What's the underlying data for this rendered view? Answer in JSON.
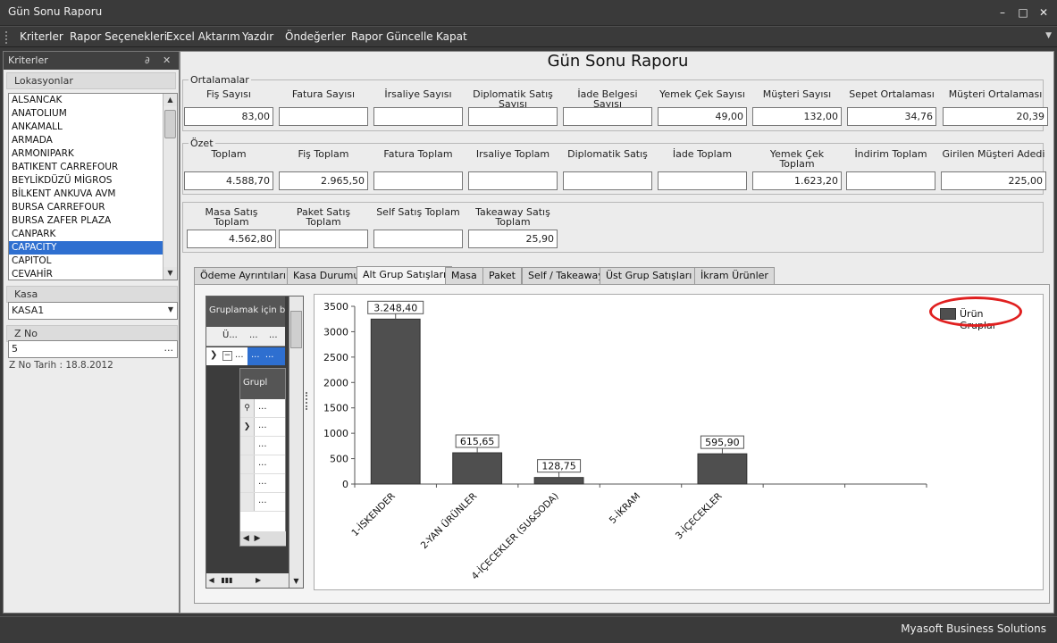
{
  "window": {
    "title": "Gün Sonu Raporu"
  },
  "menu": [
    "Kriterler",
    "Rapor Seçenekleri",
    "Excel Aktarım",
    "Yazdır",
    "Öndeğerler",
    "Rapor Güncelle",
    "Kapat"
  ],
  "left_panel": {
    "title": "Kriterler",
    "locations_label": "Lokasyonlar",
    "locations": [
      "ALSANCAK",
      "ANATOLIUM",
      "ANKAMALL",
      "ARMADA",
      "ARMONIPARK",
      "BATIKENT CARREFOUR",
      "BEYLİKDÜZÜ MİGROS",
      "BİLKENT ANKUVA AVM",
      "BURSA CARREFOUR",
      "BURSA ZAFER PLAZA",
      "CANPARK",
      "CAPACITY",
      "CAPITOL",
      "CEVAHİR"
    ],
    "selected_location": "CAPACITY",
    "kasa_label": "Kasa",
    "kasa_value": "KASA1",
    "zno_label": "Z No",
    "zno_value": "5",
    "zno_ellipsis": "...",
    "zno_date": "Z No Tarih : 18.8.2012"
  },
  "report": {
    "title": "Gün Sonu Raporu",
    "averages": {
      "legend": "Ortalamalar",
      "fields": [
        {
          "label": "Fiş Sayısı",
          "value": "83,00"
        },
        {
          "label": "Fatura Sayısı",
          "value": ""
        },
        {
          "label": "İrsaliye Sayısı",
          "value": ""
        },
        {
          "label": "Diplomatik Satış Sayısı",
          "value": ""
        },
        {
          "label": "İade Belgesi Sayısı",
          "value": ""
        },
        {
          "label": "Yemek Çek Sayısı",
          "value": "49,00"
        },
        {
          "label": "Müşteri Sayısı",
          "value": "132,00"
        },
        {
          "label": "Sepet Ortalaması",
          "value": "34,76"
        },
        {
          "label": "Müşteri Ortalaması",
          "value": "20,39"
        }
      ]
    },
    "summary": {
      "legend": "Özet",
      "fields": [
        {
          "label": "Toplam",
          "value": "4.588,70"
        },
        {
          "label": "Fiş Toplam",
          "value": "2.965,50"
        },
        {
          "label": "Fatura Toplam",
          "value": ""
        },
        {
          "label": "Irsaliye Toplam",
          "value": ""
        },
        {
          "label": "Diplomatik Satış",
          "value": ""
        },
        {
          "label": "İade Toplam",
          "value": ""
        },
        {
          "label": "Yemek Çek Toplam",
          "value": "1.623,20"
        },
        {
          "label": "İndirim Toplam",
          "value": ""
        },
        {
          "label": "Girilen Müşteri Adedi",
          "value": "225,00"
        }
      ]
    },
    "sales": {
      "fields": [
        {
          "label": "Masa Satış Toplam",
          "value": "4.562,80"
        },
        {
          "label": "Paket Satış Toplam",
          "value": ""
        },
        {
          "label": "Self Satış Toplam",
          "value": ""
        },
        {
          "label": "Takeaway Satış Toplam",
          "value": "25,90"
        }
      ]
    }
  },
  "tabs": [
    "Ödeme Ayrıntıları",
    "Kasa Durumu",
    "Alt Grup Satışları",
    "Masa",
    "Paket",
    "Self / Takeaway",
    "Üst Grup Satışları",
    "İkram Ürünler"
  ],
  "active_tab": "Alt Grup Satışları",
  "grid": {
    "group_hint": "Gruplamak için bir",
    "col1": "Ü...",
    "col2": "...",
    "col3": "...",
    "sub_title": "Grupl",
    "ellipsis": "..."
  },
  "chart_data": {
    "type": "bar",
    "categories": [
      "1-İSKENDER",
      "2-YAN ÜRÜNLER",
      "4-İÇECEKLER (SU&SODA)",
      "5-İKRAM",
      "3-İÇECEKLER"
    ],
    "series": [
      {
        "name": "Ürün Gruplar",
        "values": [
          3248.4,
          615.65,
          128.75,
          0,
          595.9
        ]
      }
    ],
    "value_labels": [
      "3.248,40",
      "615,65",
      "128,75",
      "",
      "595,90"
    ],
    "yticks": [
      0,
      500,
      1000,
      1500,
      2000,
      2500,
      3000,
      3500
    ],
    "ylim": [
      0,
      3500
    ],
    "slots": 7,
    "bar_color": "#4f4f4f",
    "grid": false,
    "legend_position": "top-right"
  },
  "status": {
    "text": "Myasoft Business Solutions"
  }
}
